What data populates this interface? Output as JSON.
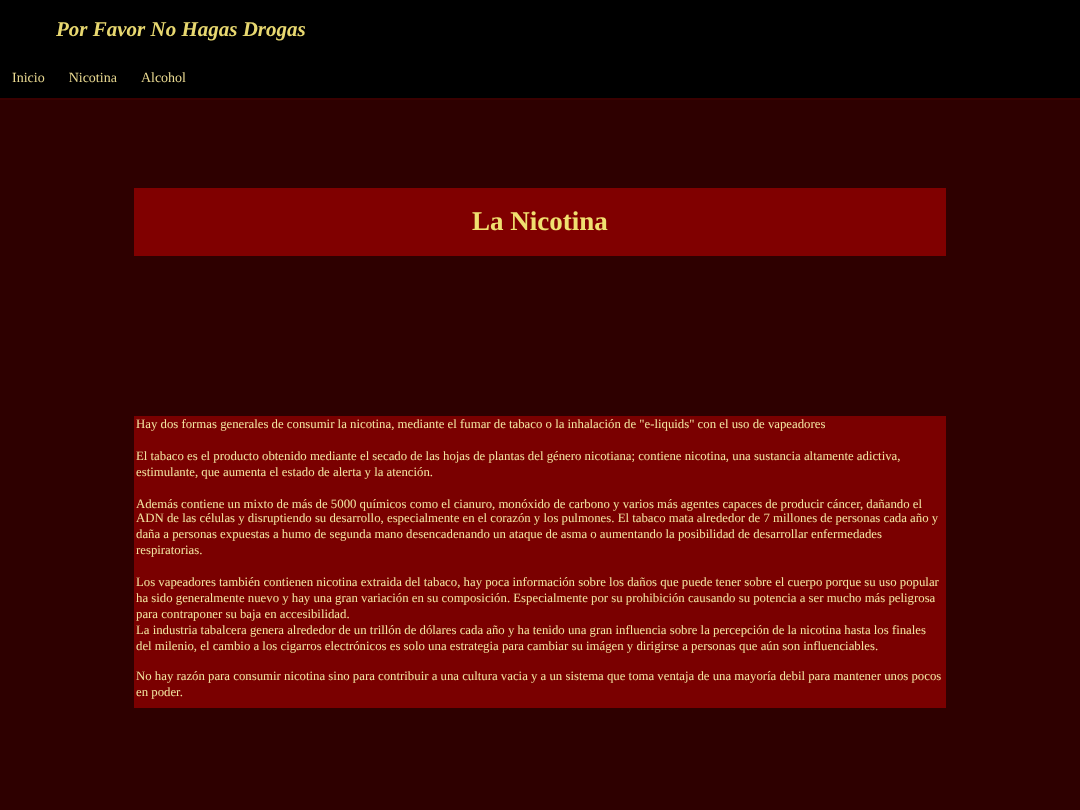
{
  "header": {
    "title": "Por Favor No Hagas Drogas"
  },
  "nav": [
    {
      "label": "Inicio"
    },
    {
      "label": "Nicotina"
    },
    {
      "label": "Alcohol"
    }
  ],
  "heading": "La Nicotina",
  "paragraphs": [
    {
      "lines": [
        "Hay dos formas generales de consumir la nicotina, mediante el fumar de tabaco o la inhalación de \"e-liquids\" con el uso de vapeadores"
      ]
    },
    {
      "lines": [
        "El tabaco es el producto obtenido mediante el secado de las hojas de plantas del género nicotiana; contiene nicotina, una sustancia altamente adictiva, estimulante, que aumenta el estado de alerta y la atención."
      ]
    },
    {
      "lines": [
        "Además contiene un mixto de más de 5000 químicos como el cianuro, monóxido de carbono y varios más agentes capaces de producir cáncer, dañando el ADN de las células y disruptiendo su desarrollo, especialmente en el corazón y los pulmones. El tabaco mata alrededor de 7 millones de personas cada año y daña a personas expuestas a humo de segunda mano desencadenando un ataque de asma o aumentando la posibilidad de desarrollar enfermedades respiratorias."
      ]
    },
    {
      "lines": [
        "Los vapeadores también contienen nicotina extraida del tabaco, hay poca información sobre los daños que puede tener sobre el cuerpo porque su uso popular ha sido generalmente nuevo y hay una gran variación en su composición. Especialmente por su prohibición causando su potencia a ser mucho más peligrosa para contraponer su baja en accesibilidad.",
        "La industria tabalcera genera alrededor de un trillón de dólares cada año y ha tenido una gran influencia sobre la percepción de la nicotina hasta los finales del milenio, el cambio a los cigarros electrónicos es solo una estrategia para cambiar su imágen y dirigirse a personas que aún son influenciables."
      ]
    },
    {
      "lines": [
        "No hay razón para consumir nicotina sino para contribuir a una cultura vacia y a un sistema que toma ventaja de una mayoría debil para mantener unos pocos en poder."
      ]
    }
  ]
}
